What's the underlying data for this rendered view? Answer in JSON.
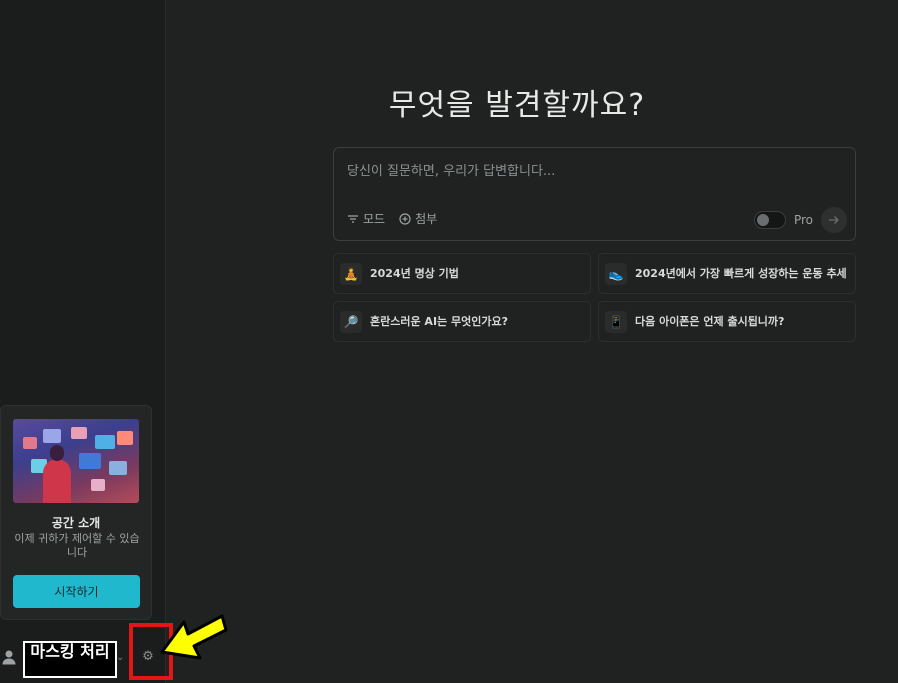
{
  "main": {
    "headline": "무엇을 발견할까요?",
    "ask": {
      "placeholder": "당신이 질문하면, 우리가 답변합니다...",
      "mode_label": "모드",
      "attach_label": "첨부",
      "pro_label": "Pro",
      "send_icon": "arrow-right-icon"
    },
    "suggestions": [
      {
        "icon": "🧘",
        "text": "2024년 명상 기법"
      },
      {
        "icon": "👟",
        "text": "2024년에서 가장 빠르게 성장하는 운동 추세"
      },
      {
        "icon": "🔎",
        "text": "혼란스러운 AI는 무엇인가요?"
      },
      {
        "icon": "📱",
        "text": "다음 아이폰은 언제 출시됩니까?"
      }
    ]
  },
  "sidebar": {
    "promo": {
      "title": "공간 소개",
      "subtitle": "이제 귀하가 제어할 수 있습니다",
      "button": "시작하기"
    },
    "user": {
      "masked_label": "마스킹 처리",
      "chevron": "⌄",
      "gear": "⚙"
    }
  },
  "colors": {
    "background": "#202222",
    "sidebar": "#1b1c1c",
    "accent": "#20b8cd",
    "highlight_box": "#e31616",
    "arrow": "#ffff00"
  }
}
